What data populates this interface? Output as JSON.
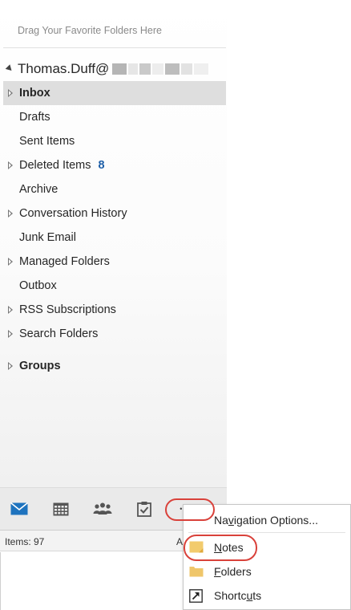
{
  "favorites_hint": "Drag Your Favorite Folders Here",
  "account": {
    "name": "Thomas.Duff@"
  },
  "folders": [
    {
      "label": "Inbox",
      "bold": true,
      "expandable": true,
      "selected": true
    },
    {
      "label": "Drafts",
      "bold": false,
      "expandable": false
    },
    {
      "label": "Sent Items",
      "bold": false,
      "expandable": false
    },
    {
      "label": "Deleted Items",
      "bold": false,
      "expandable": true,
      "count": "8"
    },
    {
      "label": "Archive",
      "bold": false,
      "expandable": false
    },
    {
      "label": "Conversation History",
      "bold": false,
      "expandable": true
    },
    {
      "label": "Junk Email",
      "bold": false,
      "expandable": false
    },
    {
      "label": "Managed Folders",
      "bold": false,
      "expandable": true
    },
    {
      "label": "Outbox",
      "bold": false,
      "expandable": false
    },
    {
      "label": "RSS Subscriptions",
      "bold": false,
      "expandable": true
    },
    {
      "label": "Search Folders",
      "bold": false,
      "expandable": true
    }
  ],
  "groups": {
    "label": "Groups"
  },
  "nav_bar": {
    "icons": [
      "mail-icon",
      "calendar-icon",
      "people-icon",
      "tasks-icon",
      "more-options-icon"
    ],
    "more_label": "• • •"
  },
  "status_bar": {
    "items": "Items: 97",
    "right_fragment": "A"
  },
  "popup_menu": {
    "items": [
      {
        "pre": "Na",
        "accel": "v",
        "post": "igation Options...",
        "icon": "none"
      },
      {
        "pre": "",
        "accel": "N",
        "post": "otes",
        "icon": "notes-icon"
      },
      {
        "pre": "",
        "accel": "F",
        "post": "olders",
        "icon": "folders-icon"
      },
      {
        "pre": "Shortc",
        "accel": "u",
        "post": "ts",
        "icon": "shortcuts-icon"
      }
    ]
  },
  "colors": {
    "accent_blue": "#1e5fa8",
    "callout_red": "#d9413a",
    "selected_bg": "#dedede"
  }
}
